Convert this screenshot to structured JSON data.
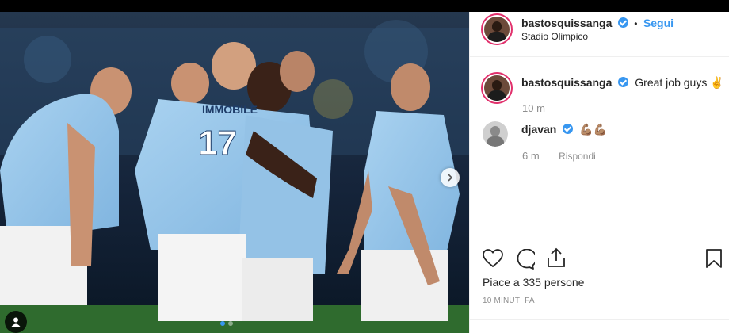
{
  "post": {
    "username": "bastosquissanga",
    "follow_label": "Segui",
    "location": "Stadio Olimpico",
    "jersey_name": "IMMOBILE",
    "jersey_number": "17"
  },
  "comments": [
    {
      "username": "bastosquissanga",
      "text": "Great job guys ✌️",
      "time": "10 m"
    },
    {
      "username": "djavan",
      "text": "💪🏽💪🏽",
      "time": "6 m",
      "reply_label": "Rispondi"
    }
  ],
  "likes_text": "Piace a 335 persone",
  "time_ago": "10 MINUTI FA",
  "carousel": {
    "slides": 2,
    "active": 1
  },
  "icons": [
    "verified-badge-icon",
    "heart-icon",
    "comment-icon",
    "share-icon",
    "bookmark-icon",
    "chevron-right-icon",
    "user-tag-icon"
  ],
  "colors": {
    "accent": "#3897f0",
    "text": "#262626",
    "muted": "#8e8e8e",
    "border": "#efefef"
  }
}
